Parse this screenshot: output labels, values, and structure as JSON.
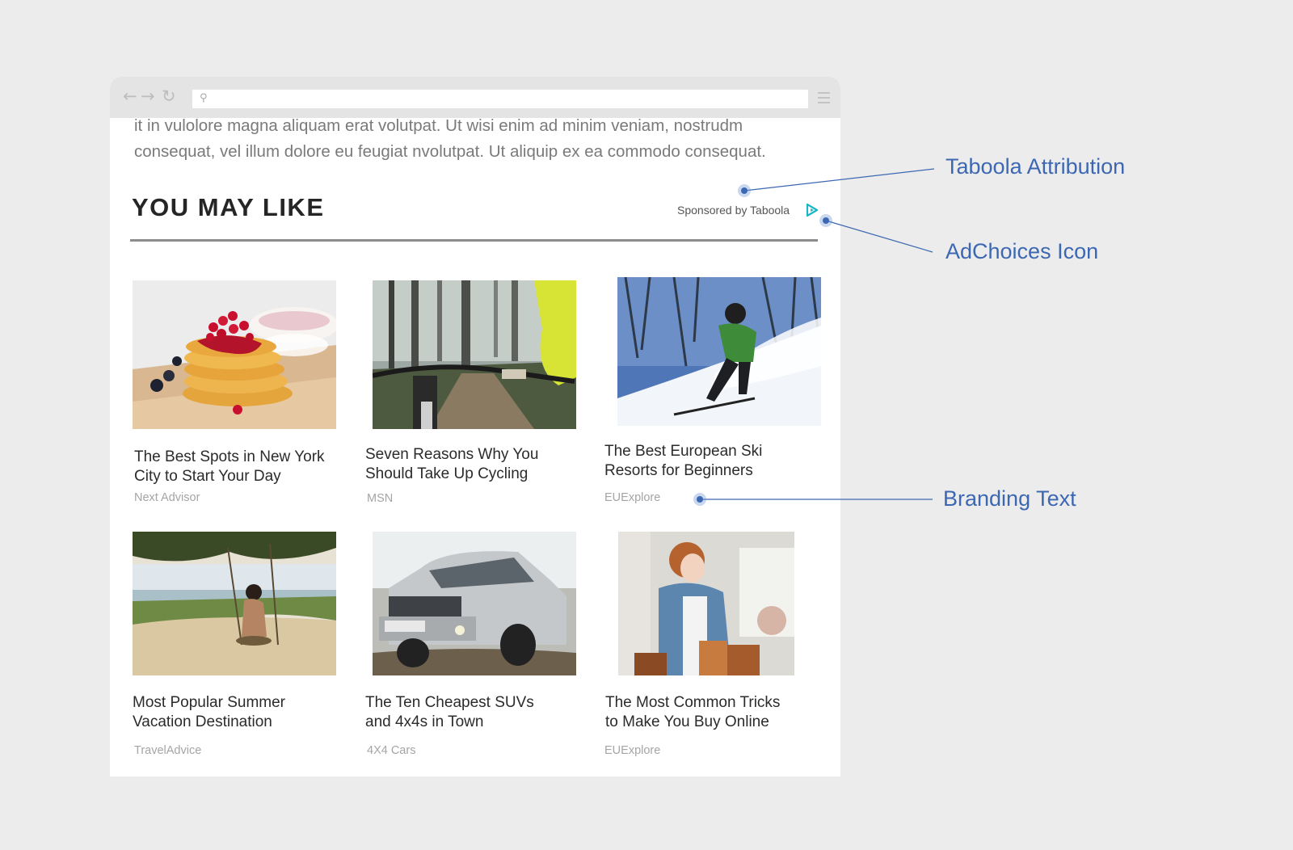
{
  "browser": {
    "nav": {
      "back_icon": "back-arrow-icon",
      "forward_icon": "forward-arrow-icon",
      "reload_icon": "reload-icon",
      "menu_icon": "hamburger-menu-icon"
    },
    "search_icon": "search-icon",
    "url": ""
  },
  "article": {
    "line1": "it in vulolore magna aliquam erat volutpat. Ut wisi enim ad minim veniam, nostrudm",
    "line2": "consequat, vel illum dolore eu feugiat nvolutpat. Ut aliquip ex ea commodo consequat."
  },
  "widget": {
    "title": "YOU MAY LIKE",
    "sponsored": "Sponsored by Taboola",
    "adchoices_icon": "adchoices-icon",
    "adchoices_color": "#1ab5c9",
    "cards": [
      {
        "title_line1": "The Best Spots in New York",
        "title_line2": "City to Start Your Day",
        "brand": "Next Advisor"
      },
      {
        "title_line1": "Seven Reasons Why You",
        "title_line2": "Should Take Up Cycling",
        "brand": "MSN"
      },
      {
        "title_line1": "The Best European Ski",
        "title_line2": "Resorts for Beginners",
        "brand": "EUExplore"
      },
      {
        "title_line1": "Most Popular Summer",
        "title_line2": "Vacation Destination",
        "brand": "TravelAdvice"
      },
      {
        "title_line1": "The Ten Cheapest  SUVs",
        "title_line2": "and 4x4s in Town",
        "brand": "4X4 Cars"
      },
      {
        "title_line1": "The Most Common Tricks",
        "title_line2": "to Make You Buy Online",
        "brand": "EUExplore"
      }
    ]
  },
  "annotations": {
    "taboola_attribution": "Taboola Attribution",
    "adchoices_icon": "AdChoices Icon",
    "branding_text": "Branding Text",
    "color": "#3c68b3"
  }
}
